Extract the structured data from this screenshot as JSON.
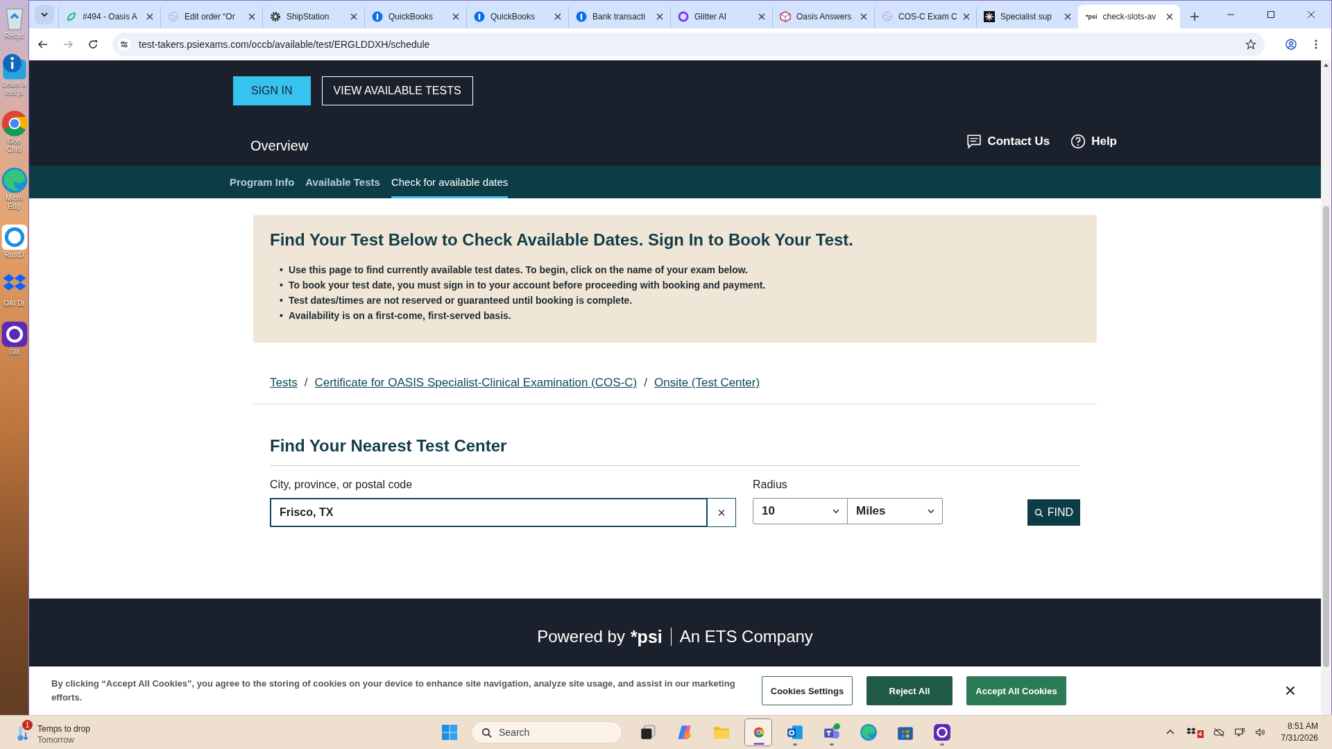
{
  "desktop_icons": [
    {
      "kind": "recycle",
      "lines": [
        "Recyc"
      ]
    },
    {
      "kind": "info",
      "lines": [
        "Learn a",
        "this pi"
      ]
    },
    {
      "kind": "chrome",
      "lines": [
        "Goo",
        "Chro"
      ]
    },
    {
      "kind": "edge",
      "lines": [
        "Micro",
        "Edg"
      ]
    },
    {
      "kind": "rustdesk",
      "lines": [
        "RustD"
      ]
    },
    {
      "kind": "dropbox",
      "lines": [
        "OAI Dr"
      ]
    },
    {
      "kind": "glitter",
      "lines": [
        "Glit"
      ]
    }
  ],
  "browser": {
    "tabs": [
      {
        "kind": "leaf",
        "title": "#494 - Oasis A",
        "selected": false
      },
      {
        "kind": "swirl",
        "title": "Edit order “Or",
        "selected": false
      },
      {
        "kind": "gear",
        "title": "ShipStation",
        "selected": false
      },
      {
        "kind": "qb",
        "title": "QuickBooks",
        "selected": false
      },
      {
        "kind": "qb",
        "title": "QuickBooks",
        "selected": false
      },
      {
        "kind": "qb",
        "title": "Bank transacti",
        "selected": false
      },
      {
        "kind": "glitter",
        "title": "Glitter AI",
        "selected": false
      },
      {
        "kind": "cube",
        "title": "Oasis Answers",
        "selected": false
      },
      {
        "kind": "swirl",
        "title": "COS-C Exam C",
        "selected": false
      },
      {
        "kind": "spark",
        "title": "Specialist sup",
        "selected": false
      },
      {
        "kind": "text",
        "favicon_text": "*psi",
        "title": "check-slots-av",
        "selected": true
      }
    ],
    "url": "test-takers.psiexams.com/occb/available/test/ERGLDDXH/schedule"
  },
  "page": {
    "header_buttons": [
      "SIGN IN",
      "VIEW AVAILABLE TESTS"
    ],
    "overview": "Overview",
    "contact": "Contact Us",
    "help": "Help",
    "nav": [
      {
        "label": "Program Info",
        "selected": false
      },
      {
        "label": "Available Tests",
        "selected": false
      },
      {
        "label": "Check for available dates",
        "selected": true
      }
    ],
    "notice": {
      "title": "Find Your Test Below to Check Available Dates. Sign In to Book Your Test.",
      "bullets": [
        "Use this page to find currently available test dates. To begin, click on the name of your exam below.",
        "To book your test date, you must sign in to your account before proceeding with booking and payment.",
        "Test dates/times are not reserved or guaranteed until booking is complete.",
        "Availability is on a first-come, first-served basis."
      ]
    },
    "breadcrumb_separator": "/",
    "bullet_marker": "•",
    "breadcrumb": [
      "Tests",
      "Certificate for OASIS Specialist-Clinical Examination (COS-C)",
      "Onsite (Test Center)"
    ],
    "section_title": "Find Your Nearest Test Center",
    "location": {
      "label": "City, province, or postal code",
      "value": "Frisco, TX",
      "clear": "×"
    },
    "radius": {
      "label": "Radius",
      "value": "10",
      "unit": "Miles"
    },
    "find_button": "FIND",
    "footer": {
      "powered_by": "Powered by",
      "logo": "*psi",
      "company": "An ETS Company"
    },
    "cookie": {
      "text": "By clicking “Accept All Cookies”, you agree to the storing of cookies on your device to enhance site navigation, analyze site usage, and assist in our marketing efforts.",
      "buttons": [
        {
          "kind": "outline",
          "label": "Cookies Settings"
        },
        {
          "kind": "solid",
          "label": "Reject All"
        },
        {
          "kind": "accent",
          "label": "Accept All Cookies"
        }
      ],
      "close": "×"
    }
  },
  "taskbar": {
    "weather": {
      "badge": "1",
      "title": "Temps to drop",
      "subtitle": "Tomorrow"
    },
    "search_placeholder": "Search",
    "apps": [
      {
        "kind": "taskview",
        "selected": false,
        "running": false
      },
      {
        "kind": "copilot",
        "selected": false,
        "running": false
      },
      {
        "kind": "folder",
        "selected": false,
        "running": false
      },
      {
        "kind": "chrome",
        "selected": true,
        "running": true
      },
      {
        "kind": "outlook",
        "selected": false,
        "running": true
      },
      {
        "kind": "teams",
        "selected": false,
        "running": true
      },
      {
        "kind": "edge",
        "selected": false,
        "running": false
      },
      {
        "kind": "store",
        "selected": false,
        "running": false
      },
      {
        "kind": "glitter",
        "selected": false,
        "running": true
      }
    ],
    "tray_badge": "4",
    "time": "8:51 AM",
    "date": "7/31/2026"
  }
}
